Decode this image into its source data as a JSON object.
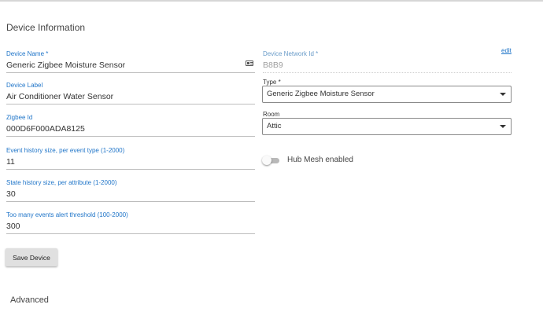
{
  "section_title": "Device Information",
  "left_fields": {
    "device_name": {
      "label": "Device Name *",
      "value": "Generic Zigbee Moisture Sensor"
    },
    "device_label": {
      "label": "Device Label",
      "value": "Air Conditioner Water Sensor"
    },
    "zigbee_id": {
      "label": "Zigbee Id",
      "value": "000D6F000ADA8125"
    },
    "event_history": {
      "label": "Event history size, per event type (1-2000)",
      "value": "11"
    },
    "state_history": {
      "label": "State history size, per attribute (1-2000)",
      "value": "30"
    },
    "too_many_events": {
      "label": "Too many events alert threshold (100-2000)",
      "value": "300"
    }
  },
  "right_fields": {
    "network_id": {
      "label": "Device Network Id *",
      "value": "B8B9",
      "edit_label": "edit"
    },
    "type": {
      "label": "Type *",
      "value": "Generic Zigbee Moisture Sensor"
    },
    "room": {
      "label": "Room",
      "value": "Attic"
    },
    "hub_mesh": {
      "label": "Hub Mesh enabled",
      "enabled": false
    }
  },
  "buttons": {
    "save_label": "Save Device"
  },
  "advanced_title": "Advanced",
  "icons": {
    "device_name_icon": "id-card-icon",
    "select_icon": "caret-down-icon"
  },
  "colors": {
    "accent": "#1e74c8",
    "button_bg": "#e0e0e0"
  }
}
